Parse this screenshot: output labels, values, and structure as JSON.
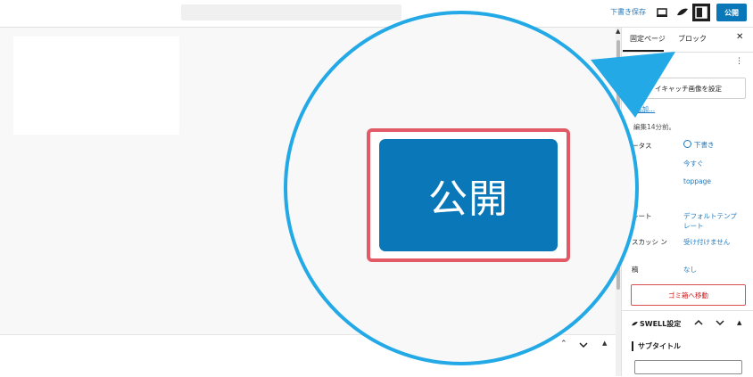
{
  "header": {
    "save_draft": "下書き保存",
    "publish": "公開"
  },
  "sidebar": {
    "tabs": [
      "固定ページ",
      "ブロック"
    ],
    "featured_image_button": "イキャッチ画像を設定",
    "add_link": "追加...",
    "edited": "編集14分前。",
    "rows": [
      {
        "label": "ータス",
        "value": "下書き"
      },
      {
        "label": "",
        "value": "今すぐ"
      },
      {
        "label": "グ",
        "value": "toppage"
      },
      {
        "label": "レート",
        "value": "デフォルトテンプ レート"
      },
      {
        "label": "スカッシ ン",
        "value": "受け付けません"
      },
      {
        "label": "稿",
        "value": "なし"
      }
    ],
    "trash_button": "ゴミ箱へ移動",
    "swell_title": "SWELL設定",
    "subtitle_label": "サブタイトル"
  },
  "zoom": {
    "label": "公開"
  },
  "colors": {
    "accent_blue": "#0a78b8",
    "callout_blue": "#22a9e6",
    "highlight_red": "#e15a66",
    "danger_red": "#cc1818"
  }
}
